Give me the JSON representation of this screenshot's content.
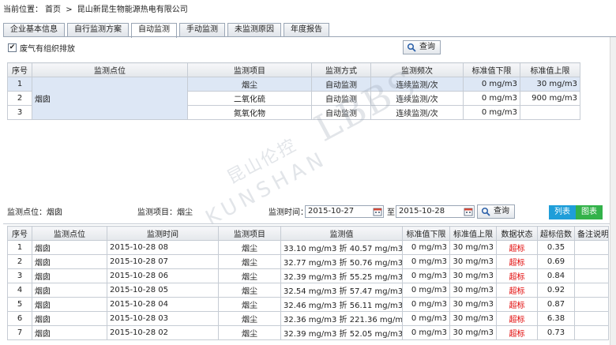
{
  "breadcrumb": {
    "prefix": "当前位置：",
    "home": "首页",
    "sep": ">",
    "company": "昆山新昆生物能源热电有限公司"
  },
  "tabs": [
    "企业基本信息",
    "自行监测方案",
    "自动监测",
    "手动监测",
    "未监测原因",
    "年度报告"
  ],
  "active_tab": "自动监测",
  "top": {
    "checkbox_label": "废气有组织排放",
    "checkbox_mark": "✔",
    "query_label": "查询",
    "headers": [
      "序号",
      "监测点位",
      "监测项目",
      "监测方式",
      "监测频次",
      "标准值下限",
      "标准值上限"
    ],
    "point": "烟囱",
    "rows": [
      {
        "no": "1",
        "item": "烟尘",
        "method": "自动监测",
        "freq": "连续监测/次",
        "low": "0 mg/m3",
        "high": "30 mg/m3"
      },
      {
        "no": "2",
        "item": "二氧化硫",
        "method": "自动监测",
        "freq": "连续监测/次",
        "low": "0 mg/m3",
        "high": "900 mg/m3"
      },
      {
        "no": "3",
        "item": "氮氧化物",
        "method": "自动监测",
        "freq": "连续监测/次",
        "low": "0 mg/m3",
        "high": ""
      }
    ]
  },
  "filter": {
    "point_label": "监测点位：烟囱",
    "item_label": "监测项目：烟尘",
    "time_label": "监测时间：",
    "start": "2015-10-27",
    "to": "至",
    "end": "2015-10-28",
    "query": "查询",
    "list_btn": "列表",
    "chart_btn": "图表"
  },
  "watermark": {
    "text1": "昆山伦控",
    "text2": "KUNSHAN",
    "text3": "LBBS"
  },
  "bottom": {
    "headers": [
      "序号",
      "监测点位",
      "监测时间",
      "监测项目",
      "监测值",
      "标准值下限",
      "标准值上限",
      "数据状态",
      "超标倍数",
      "备注说明"
    ],
    "rows": [
      {
        "no": "1",
        "point": "烟囱",
        "time": "2015-10-28 08",
        "item": "烟尘",
        "value": "33.10  mg/m3  折  40.57  mg/m3",
        "low": "0 mg/m3",
        "high": "30 mg/m3",
        "status": "超标",
        "times": "0.35",
        "note": ""
      },
      {
        "no": "2",
        "point": "烟囱",
        "time": "2015-10-28 07",
        "item": "烟尘",
        "value": "32.77  mg/m3  折  50.76  mg/m3",
        "low": "0 mg/m3",
        "high": "30 mg/m3",
        "status": "超标",
        "times": "0.69",
        "note": ""
      },
      {
        "no": "3",
        "point": "烟囱",
        "time": "2015-10-28 06",
        "item": "烟尘",
        "value": "32.39  mg/m3  折  55.25  mg/m3",
        "low": "0 mg/m3",
        "high": "30 mg/m3",
        "status": "超标",
        "times": "0.84",
        "note": ""
      },
      {
        "no": "4",
        "point": "烟囱",
        "time": "2015-10-28 05",
        "item": "烟尘",
        "value": "32.54  mg/m3  折  57.47  mg/m3",
        "low": "0 mg/m3",
        "high": "30 mg/m3",
        "status": "超标",
        "times": "0.92",
        "note": ""
      },
      {
        "no": "5",
        "point": "烟囱",
        "time": "2015-10-28 04",
        "item": "烟尘",
        "value": "32.46  mg/m3  折  56.11  mg/m3",
        "low": "0 mg/m3",
        "high": "30 mg/m3",
        "status": "超标",
        "times": "0.87",
        "note": ""
      },
      {
        "no": "6",
        "point": "烟囱",
        "time": "2015-10-28 03",
        "item": "烟尘",
        "value": "32.36  mg/m3  折  221.36  mg/m3",
        "low": "0 mg/m3",
        "high": "30 mg/m3",
        "status": "超标",
        "times": "6.38",
        "note": ""
      },
      {
        "no": "7",
        "point": "烟囱",
        "time": "2015-10-28 02",
        "item": "烟尘",
        "value": "32.39  mg/m3  折  52.05  mg/m3",
        "low": "0 mg/m3",
        "high": "30 mg/m3",
        "status": "超标",
        "times": "0.73",
        "note": ""
      }
    ]
  },
  "colors": {
    "accent_blue": "#1f9ed9",
    "accent_green": "#33b24a",
    "exceed_red": "#e00000",
    "selected_row": "#dde7f5"
  }
}
